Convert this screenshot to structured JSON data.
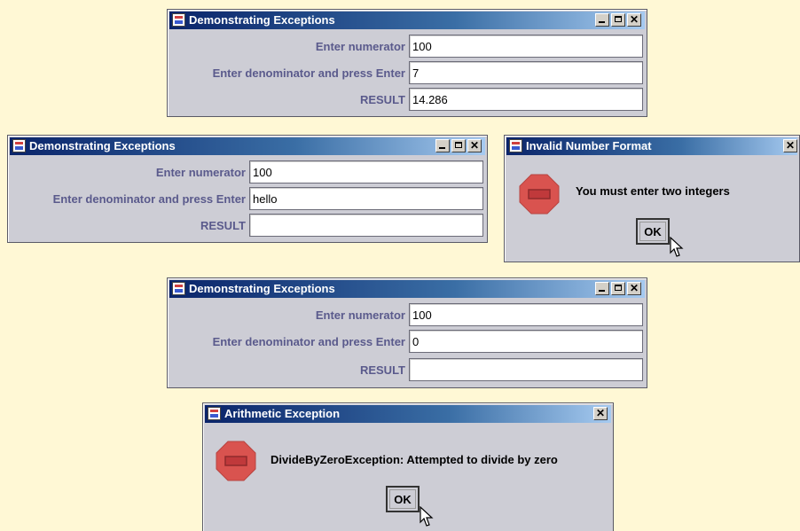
{
  "window1": {
    "title": "Demonstrating Exceptions",
    "numerator_label": "Enter numerator",
    "numerator_value": "100",
    "denominator_label": "Enter denominator and press Enter",
    "denominator_value": "7",
    "result_label": "RESULT",
    "result_value": "14.286"
  },
  "window2": {
    "title": "Demonstrating Exceptions",
    "numerator_label": "Enter numerator",
    "numerator_value": "100",
    "denominator_label": "Enter denominator and press Enter",
    "denominator_value": "hello",
    "result_label": "RESULT",
    "result_value": ""
  },
  "dialog1": {
    "title": "Invalid Number Format",
    "message": "You must enter two integers",
    "ok_label": "OK"
  },
  "window3": {
    "title": "Demonstrating Exceptions",
    "numerator_label": "Enter numerator",
    "numerator_value": "100",
    "denominator_label": "Enter denominator and press Enter",
    "denominator_value": "0",
    "result_label": "RESULT",
    "result_value": ""
  },
  "dialog2": {
    "title": "Arithmetic Exception",
    "message": "DivideByZeroException: Attempted to divide by zero",
    "ok_label": "OK"
  },
  "icons": {
    "app": "java-cup-icon",
    "minimize": "minimize-icon",
    "maximize": "maximize-icon",
    "close": "close-icon",
    "error": "stop-sign-icon",
    "pointer": "mouse-pointer-icon"
  },
  "colors": {
    "background": "#fff8d5",
    "titlebar_start": "#0a246a",
    "titlebar_end": "#a6caf0",
    "label_text": "#5a5a8c",
    "stop_sign": "#d9534f"
  }
}
